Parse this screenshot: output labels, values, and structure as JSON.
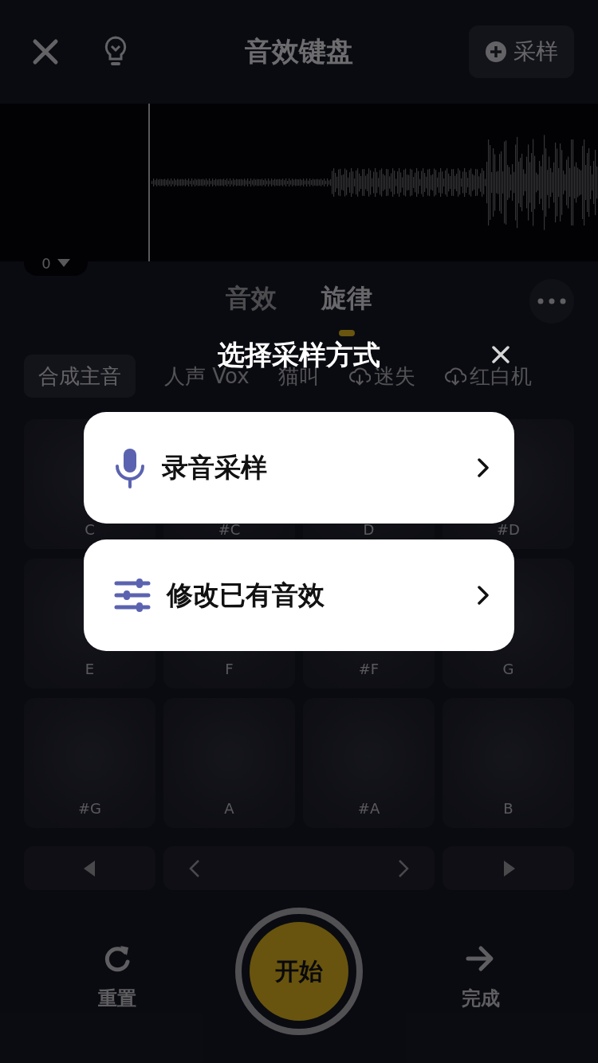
{
  "header": {
    "title": "音效键盘",
    "sample_button": "采样"
  },
  "waveform": {
    "position_label": "0"
  },
  "tabs": [
    {
      "label": "音效",
      "selected": false
    },
    {
      "label": "旋律",
      "selected": true
    }
  ],
  "categories": [
    {
      "label": "合成主音",
      "selected": true,
      "download": false
    },
    {
      "label": "人声 Vox",
      "selected": false,
      "download": false
    },
    {
      "label": "猫叫",
      "selected": false,
      "download": false
    },
    {
      "label": "迷失",
      "selected": false,
      "download": true
    },
    {
      "label": "红白机",
      "selected": false,
      "download": true
    }
  ],
  "pads": [
    {
      "note": "C"
    },
    {
      "note": "#C"
    },
    {
      "note": "D"
    },
    {
      "note": "#D"
    },
    {
      "note": "E"
    },
    {
      "note": "F"
    },
    {
      "note": "#F"
    },
    {
      "note": "G"
    },
    {
      "note": "#G"
    },
    {
      "note": "A"
    },
    {
      "note": "#A"
    },
    {
      "note": "B"
    }
  ],
  "bottom": {
    "reset": "重置",
    "start": "开始",
    "done": "完成"
  },
  "dialog": {
    "title": "选择采样方式",
    "options": [
      {
        "kind": "record",
        "label": "录音采样"
      },
      {
        "kind": "edit",
        "label": "修改已有音效"
      }
    ]
  }
}
